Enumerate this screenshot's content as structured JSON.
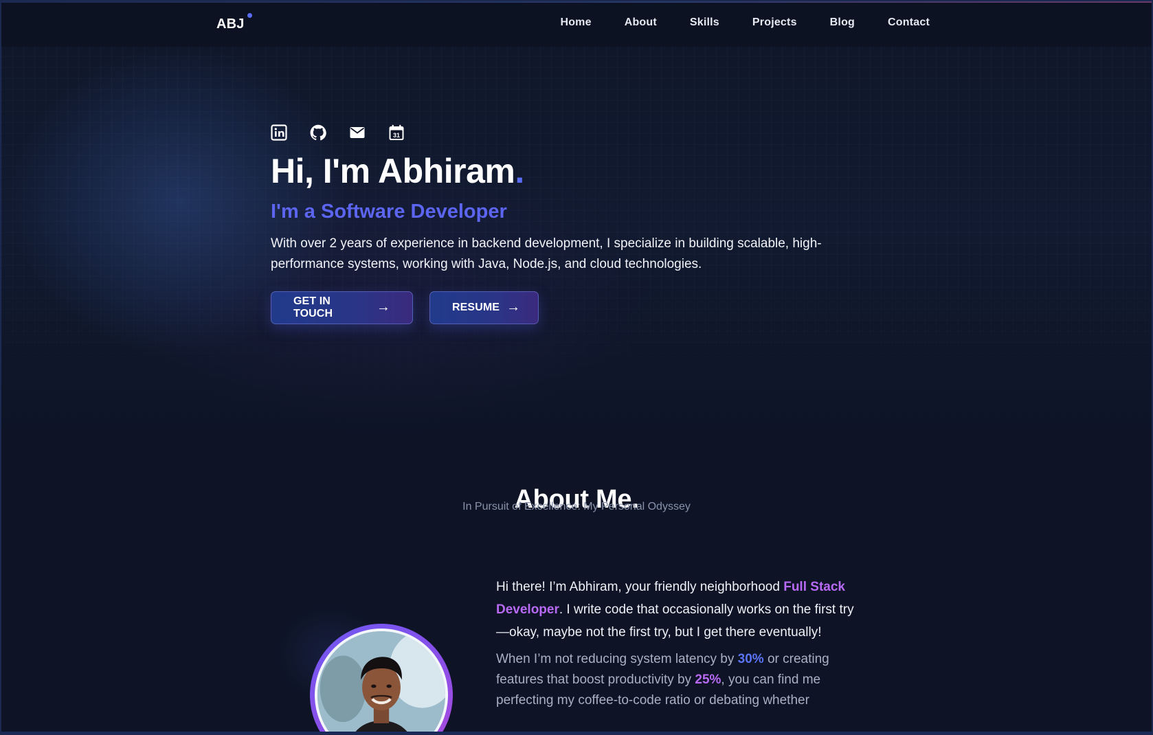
{
  "nav": {
    "logo": "ABJ",
    "links": [
      "Home",
      "About",
      "Skills",
      "Projects",
      "Blog",
      "Contact"
    ]
  },
  "hero": {
    "socials": [
      {
        "icon": "linkedin-icon",
        "label": "LinkedIn"
      },
      {
        "icon": "github-icon",
        "label": "GitHub"
      },
      {
        "icon": "mail-icon",
        "label": "Email"
      },
      {
        "icon": "calendar-icon",
        "label": "Calendar",
        "text": "31"
      }
    ],
    "title": "Hi, I'm Abhiram",
    "title_dot": ".",
    "subtitle": "I'm a Software Developer",
    "description": "With over 2 years of experience in backend development, I specialize in building scalable, high-performance systems, working with Java, Node.js, and cloud technologies.",
    "buttons": {
      "contact": "GET IN TOUCH",
      "resume": "RESUME",
      "arrow": "→"
    }
  },
  "about": {
    "heading": "About Me.",
    "subheading": "In Pursuit of Excellence: My Personal Odyssey",
    "p1_pre": "Hi there! I’m Abhiram, your friendly neighborhood ",
    "p1_highlight": "Full Stack Developer",
    "p1_post": ". I write code that occasionally works on the first try—okay, maybe not the first try, but I get there eventually!",
    "p2_a": "When I’m not reducing system latency by ",
    "p2_num1": "30%",
    "p2_b": " or creating features that boost productivity by ",
    "p2_num2": "25%",
    "p2_c": ", you can find me perfecting my coffee-to-code ratio or debating whether"
  },
  "colors": {
    "background": "#0e1426",
    "accent": "#5b6cf5",
    "highlight_purple": "#b86af5",
    "subtitle_blue": "#5c65f0"
  }
}
